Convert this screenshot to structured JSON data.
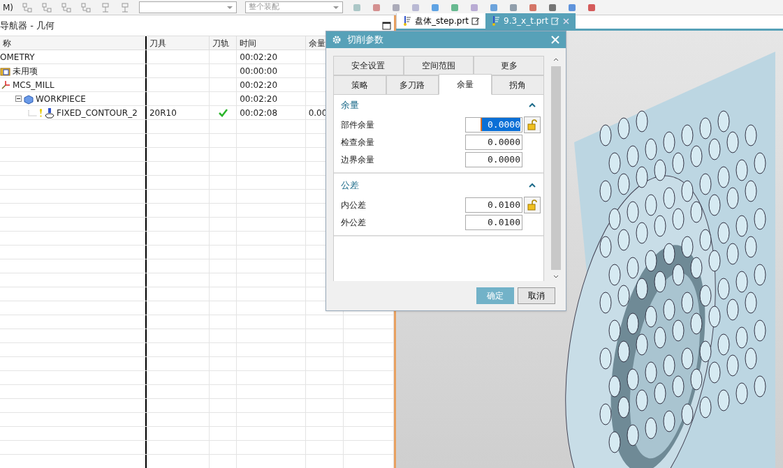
{
  "toolbar": {
    "menu_label": "M)",
    "scope_dropdown": {
      "value": "整个装配"
    }
  },
  "navigator": {
    "title": "导航器 - 几何",
    "columns": [
      "称",
      "刀具",
      "刀轨",
      "时间",
      "余量"
    ],
    "tree": [
      {
        "name": "OMETRY",
        "time": "00:02:20",
        "children": [
          {
            "name": "未用项",
            "kind": "folder",
            "time": "00:00:00"
          },
          {
            "name": "MCS_MILL",
            "kind": "csys",
            "time": "00:02:20",
            "children": [
              {
                "name": "WORKPIECE",
                "kind": "workpiece",
                "expanded": true,
                "time": "00:02:20",
                "children": [
                  {
                    "name": "FIXED_CONTOUR_2",
                    "kind": "operation",
                    "tool": "20R10",
                    "toolpath_ok": true,
                    "time": "00:02:08",
                    "stock": "0.00"
                  }
                ]
              }
            ]
          }
        ]
      }
    ]
  },
  "file_tabs": [
    {
      "label": "盘体_step.prt",
      "selected": false
    },
    {
      "label": "9.3_x_t.prt",
      "selected": true
    }
  ],
  "dialog": {
    "title": "切削参数",
    "tab_rows": [
      [
        {
          "label": "安全设置",
          "selected": false
        },
        {
          "label": "空间范围",
          "selected": false
        },
        {
          "label": "更多",
          "selected": false
        }
      ],
      [
        {
          "label": "策略",
          "selected": false
        },
        {
          "label": "多刀路",
          "selected": false
        },
        {
          "label": "余量",
          "selected": true
        },
        {
          "label": "拐角",
          "selected": false
        }
      ]
    ],
    "sections": [
      {
        "title": "余量",
        "expanded": true,
        "fields": [
          {
            "label": "部件余量",
            "value": "0.0000",
            "selected": true,
            "lock": true
          },
          {
            "label": "检查余量",
            "value": "0.0000",
            "selected": false,
            "lock": false
          },
          {
            "label": "边界余量",
            "value": "0.0000",
            "selected": false,
            "lock": false
          }
        ]
      },
      {
        "title": "公差",
        "expanded": true,
        "fields": [
          {
            "label": "内公差",
            "value": "0.0100",
            "selected": false,
            "lock": true
          },
          {
            "label": "外公差",
            "value": "0.0100",
            "selected": false,
            "lock": false
          }
        ]
      }
    ],
    "buttons": [
      {
        "label": "确定",
        "kind": "primary"
      },
      {
        "label": "取消",
        "kind": "secondary"
      }
    ]
  }
}
